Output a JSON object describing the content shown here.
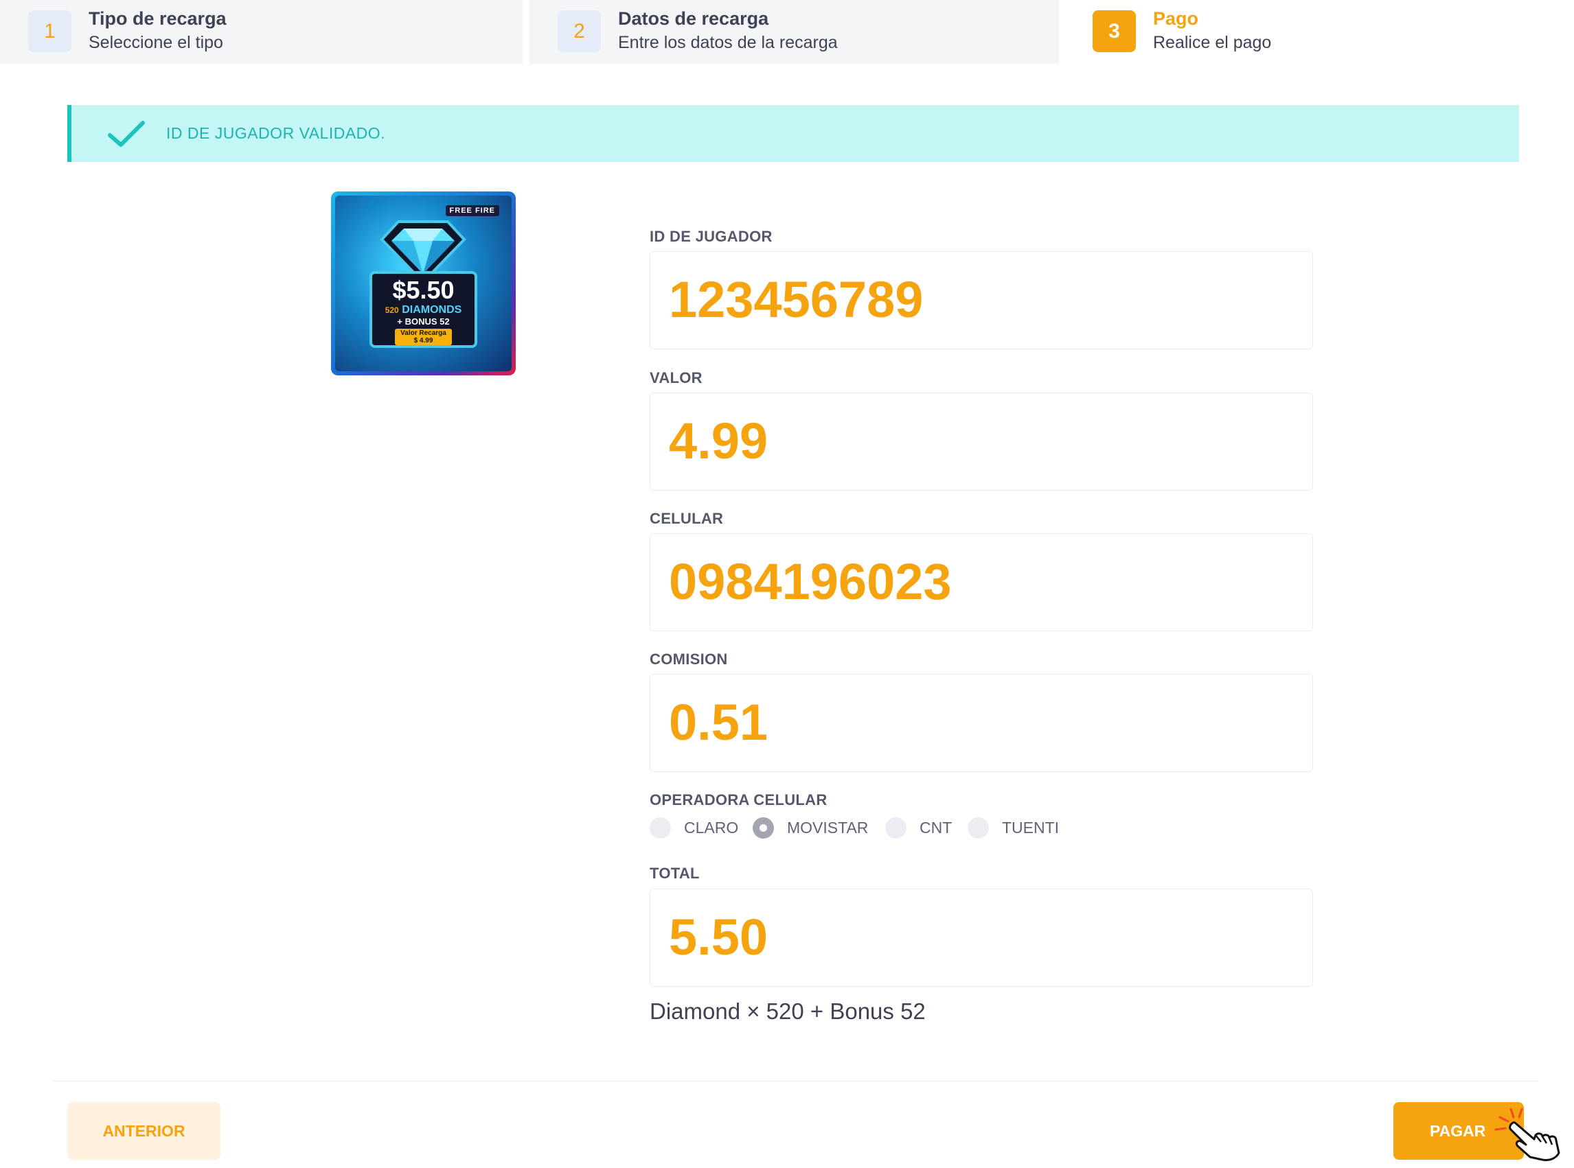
{
  "steps": [
    {
      "number": "1",
      "title": "Tipo de recarga",
      "subtitle": "Seleccione el tipo"
    },
    {
      "number": "2",
      "title": "Datos de recarga",
      "subtitle": "Entre los datos de la recarga"
    },
    {
      "number": "3",
      "title": "Pago",
      "subtitle": "Realice el pago"
    }
  ],
  "active_step": 3,
  "alert": {
    "icon": "check-icon",
    "text": "ID DE JUGADOR VALIDADO."
  },
  "product": {
    "brand": "FREE FIRE",
    "price": "$5.50",
    "diamonds_count": "520",
    "diamonds_label": "DIAMONDS",
    "bonus": "+ BONUS 52",
    "tag_label": "Valor Recarga",
    "tag_value": "$ 4.99"
  },
  "fields": {
    "player_id": {
      "label": "ID DE JUGADOR",
      "value": "123456789"
    },
    "valor": {
      "label": "VALOR",
      "value": "4.99"
    },
    "celular": {
      "label": "CELULAR",
      "value": "0984196023"
    },
    "comision": {
      "label": "COMISION",
      "value": "0.51"
    },
    "total": {
      "label": "TOTAL",
      "value": "5.50"
    }
  },
  "operadora": {
    "label": "OPERADORA CELULAR",
    "options": [
      "CLARO",
      "MOVISTAR",
      "CNT",
      "TUENTI"
    ],
    "selected": "MOVISTAR"
  },
  "summary": "Diamond × 520 + Bonus 52",
  "buttons": {
    "previous": "ANTERIOR",
    "pay": "PAGAR"
  },
  "colors": {
    "accent": "#f6a310",
    "success": "#1bc5bd",
    "success_bg": "#c4f6f6"
  }
}
